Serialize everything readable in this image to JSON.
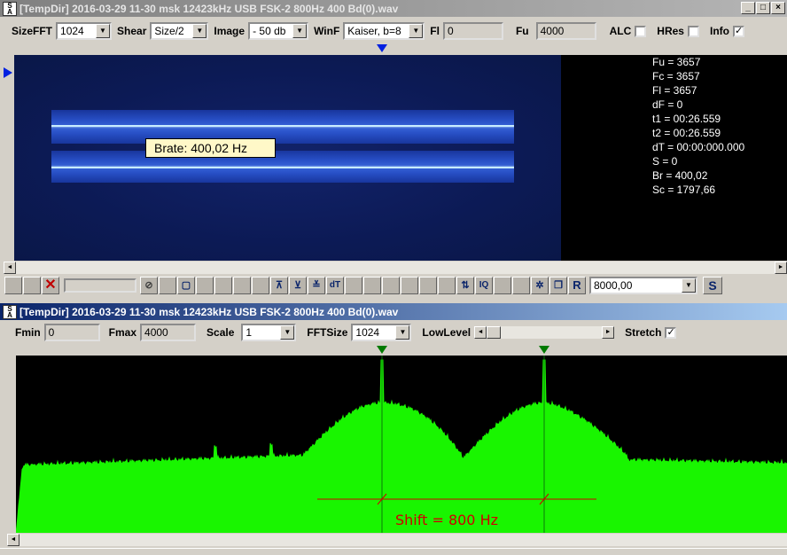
{
  "top_window": {
    "title": "[TempDir] 2016-03-29 11-30 msk 12423kHz USB FSK-2 800Hz 400 Bd(0).wav",
    "controls": {
      "sizefft_label": "SizeFFT",
      "sizefft_value": "1024",
      "shear_label": "Shear",
      "shear_value": "Size/2",
      "image_label": "Image",
      "image_value": "- 50 db",
      "winf_label": "WinF",
      "winf_value": "Kaiser, b=8",
      "fl_label": "Fl",
      "fl_value": "0",
      "fu_label": "Fu",
      "fu_value": "4000",
      "alc_label": "ALC",
      "alc_checked": false,
      "hres_label": "HRes",
      "hres_checked": false,
      "info_label": "Info",
      "info_checked": true
    },
    "tooltip": "Brate: 400,02 Hz",
    "info": [
      "Fu = 3657",
      "Fc = 3657",
      "Fl = 3657",
      "dF = 0",
      "t1 = 00:26.559",
      "t2 = 00:26.559",
      "dT = 00:00:000.000",
      "S = 0",
      "Br = 400,02",
      "Sc = 1797,66"
    ],
    "rate_value": "8000,00",
    "s_button": "S",
    "tool_labels": {
      "dt": "dT",
      "iq": "IQ",
      "r": "R"
    }
  },
  "bottom_window": {
    "title": "[TempDir] 2016-03-29 11-30 msk 12423kHz USB FSK-2 800Hz 400 Bd(0).wav",
    "controls": {
      "fmin_label": "Fmin",
      "fmin_value": "0",
      "fmax_label": "Fmax",
      "fmax_value": "4000",
      "scale_label": "Scale",
      "scale_value": "1",
      "fftsize_label": "FFTSize",
      "fftsize_value": "1024",
      "lowlevel_label": "LowLevel",
      "stretch_label": "Stretch",
      "stretch_checked": true
    },
    "shift_label": "Shift = 800 Hz"
  },
  "colors": {
    "active_title": "#0a246a",
    "spectrum_fill": "#19f500",
    "spectrum_bg": "#000000",
    "marker": "#007a00",
    "shift_text": "#d00000",
    "spectrogram_bg": "#0c1a55"
  }
}
